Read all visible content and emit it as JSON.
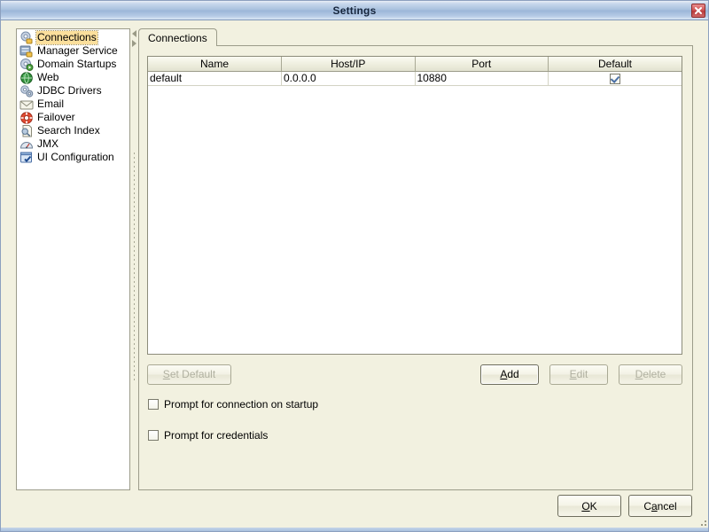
{
  "window": {
    "title": "Settings",
    "close_label": "✖"
  },
  "sidebar": {
    "items": [
      {
        "label": "Connections",
        "icon": "gear-connections-icon",
        "selected": true
      },
      {
        "label": "Manager Service",
        "icon": "server-service-icon",
        "selected": false
      },
      {
        "label": "Domain Startups",
        "icon": "gear-play-icon",
        "selected": false
      },
      {
        "label": "Web",
        "icon": "globe-icon",
        "selected": false
      },
      {
        "label": "JDBC Drivers",
        "icon": "gears-icon",
        "selected": false
      },
      {
        "label": "Email",
        "icon": "envelope-icon",
        "selected": false
      },
      {
        "label": "Failover",
        "icon": "lifering-icon",
        "selected": false
      },
      {
        "label": "Search Index",
        "icon": "document-search-icon",
        "selected": false
      },
      {
        "label": "JMX",
        "icon": "gauge-icon",
        "selected": false
      },
      {
        "label": "UI Configuration",
        "icon": "window-check-icon",
        "selected": false
      }
    ]
  },
  "divider": {
    "collapse_left_icon": "triangle-left-icon",
    "collapse_right_icon": "triangle-right-icon"
  },
  "tabs": [
    {
      "label": "Connections",
      "selected": true
    }
  ],
  "table": {
    "columns": [
      "Name",
      "Host/IP",
      "Port",
      "Default"
    ],
    "rows": [
      {
        "name": "default",
        "host": "0.0.0.0",
        "port": "10880",
        "default": true
      }
    ]
  },
  "buttons": {
    "set_default": {
      "label": "Set Default",
      "mnemonic": "S",
      "enabled": false
    },
    "add": {
      "label": "Add",
      "mnemonic": "A",
      "enabled": true,
      "focused": true
    },
    "edit": {
      "label": "Edit",
      "mnemonic": "E",
      "enabled": false
    },
    "delete": {
      "label": "Delete",
      "mnemonic": "D",
      "enabled": false
    }
  },
  "options": [
    {
      "label": "Prompt for connection on startup",
      "checked": false
    },
    {
      "label": "Prompt for credentials",
      "checked": false
    }
  ],
  "footer": {
    "ok": {
      "label": "OK",
      "mnemonic": "O"
    },
    "cancel": {
      "label": "Cancel",
      "mnemonic": "a"
    }
  },
  "colors": {
    "titlebar_accent": "#9cb6d8",
    "panel_bg": "#f2f1e0",
    "selection": "#fbdf9c",
    "check_blue": "#4a6fa5",
    "close_red": "#b93c3c"
  }
}
